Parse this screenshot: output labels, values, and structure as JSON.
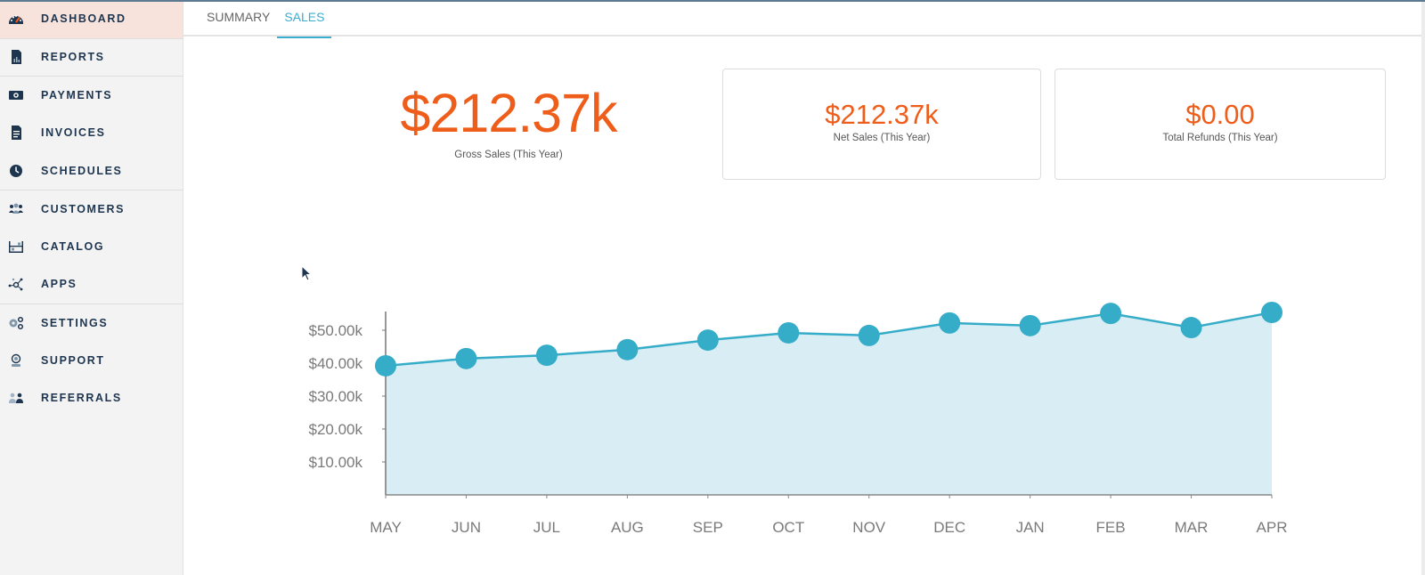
{
  "sidebar": {
    "items": [
      {
        "label": "DASHBOARD",
        "icon": "dashboard-gauge-icon",
        "active": true
      },
      {
        "label": "REPORTS",
        "icon": "reports-document-icon",
        "active": false
      },
      {
        "label": "PAYMENTS",
        "icon": "payments-cash-icon",
        "active": false
      },
      {
        "label": "INVOICES",
        "icon": "invoices-document-icon",
        "active": false
      },
      {
        "label": "SCHEDULES",
        "icon": "schedules-clock-icon",
        "active": false
      },
      {
        "label": "CUSTOMERS",
        "icon": "customers-group-icon",
        "active": false
      },
      {
        "label": "CATALOG",
        "icon": "catalog-shelf-icon",
        "active": false
      },
      {
        "label": "APPS",
        "icon": "apps-network-icon",
        "active": false
      },
      {
        "label": "SETTINGS",
        "icon": "settings-gears-icon",
        "active": false
      },
      {
        "label": "SUPPORT",
        "icon": "support-headset-icon",
        "active": false
      },
      {
        "label": "REFERRALS",
        "icon": "referrals-people-icon",
        "active": false
      }
    ]
  },
  "tabs": [
    {
      "label": "SUMMARY",
      "active": false
    },
    {
      "label": "SALES",
      "active": true
    }
  ],
  "metrics": {
    "gross": {
      "value": "$212.37k",
      "label": "Gross Sales (This Year)"
    },
    "net": {
      "value": "$212.37k",
      "label": "Net Sales (This Year)"
    },
    "refunds": {
      "value": "$0.00",
      "label": "Total Refunds (This Year)"
    }
  },
  "colors": {
    "accent_orange": "#ee5d1a",
    "accent_blue": "#35acc8",
    "area_fill": "#d8edf4",
    "active_nav_bg": "#f7e3dc"
  },
  "chart_data": {
    "type": "area",
    "title": "",
    "xlabel": "",
    "ylabel": "",
    "categories": [
      "MAY",
      "JUN",
      "JUL",
      "AUG",
      "SEP",
      "OCT",
      "NOV",
      "DEC",
      "JAN",
      "FEB",
      "MAR",
      "APR"
    ],
    "series": [
      {
        "name": "Sales",
        "values": [
          39200,
          41400,
          42400,
          44100,
          47000,
          49200,
          48400,
          52200,
          51400,
          55100,
          50800,
          55400
        ]
      }
    ],
    "yticks": [
      10000,
      20000,
      30000,
      40000,
      50000
    ],
    "ytick_labels": [
      "$10.00k",
      "$20.00k",
      "$30.00k",
      "$40.00k",
      "$50.00k"
    ],
    "ylim": [
      0,
      55400
    ],
    "grid": false,
    "legend": "none"
  }
}
